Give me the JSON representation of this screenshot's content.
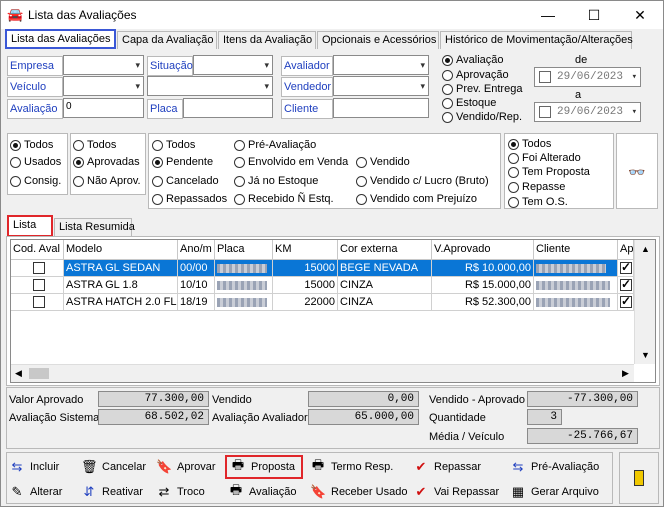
{
  "window": {
    "title": "Lista das Avaliações",
    "minimize": "—",
    "maximize": "☐",
    "close": "✕"
  },
  "tabs": [
    {
      "label": "Lista das Avaliações"
    },
    {
      "label": "Capa da Avaliação"
    },
    {
      "label": "Itens da Avaliação"
    },
    {
      "label": "Opcionais e Acessórios"
    },
    {
      "label": "Histórico de Movimentação/Alterações"
    }
  ],
  "filters": {
    "empresa_label": "Empresa",
    "veiculo_label": "Veículo",
    "avaliacao_label": "Avaliação",
    "avaliacao_value": "0",
    "situacao_label": "Situação",
    "placa_label": "Placa",
    "avaliador_label": "Avaliador",
    "vendedor_label": "Vendedor",
    "cliente_label": "Cliente"
  },
  "date_type": {
    "options": [
      "Avaliação",
      "Aprovação",
      "Prev. Entrega",
      "Estoque",
      "Vendido/Rep."
    ],
    "selected": "Avaliação",
    "from_label": "de",
    "from_value": "29/06/2023",
    "to_label": "a",
    "to_value": "29/06/2023"
  },
  "group1": {
    "options": [
      "Todos",
      "Usados",
      "Consig."
    ],
    "selected": "Todos"
  },
  "group2": {
    "options": [
      "Todos",
      "Aprovadas",
      "Não Aprov."
    ],
    "selected": "Aprovadas"
  },
  "group3": {
    "options": [
      "Todos",
      "Pré-Avaliação",
      "Pendente",
      "Envolvido em Venda",
      "Vendido",
      "Cancelado",
      "Já no Estoque",
      "Vendido c/ Lucro (Bruto)",
      "Repassados",
      "Recebido Ñ Estq.",
      "Vendido com Prejuízo"
    ],
    "selected": "Pendente"
  },
  "group4": {
    "options": [
      "Todos",
      "Foi Alterado",
      "Tem Proposta",
      "Repasse",
      "Tem O.S."
    ],
    "selected": "Todos"
  },
  "view_tabs": [
    {
      "label": "Lista"
    },
    {
      "label": "Lista Resumida"
    }
  ],
  "table": {
    "columns": [
      "Cod. Aval",
      "Modelo",
      "Ano/m",
      "Placa",
      "KM",
      "Cor externa",
      "V.Aprovado",
      "Cliente",
      "Apr"
    ],
    "rows": [
      {
        "modelo": "ASTRA GL SEDAN",
        "ano": "00/00",
        "km": "15000",
        "cor": "BEGE NEVADA",
        "valor": "R$ 10.000,00",
        "apr": true
      },
      {
        "modelo": "ASTRA GL 1.8",
        "ano": "10/10",
        "km": "15000",
        "cor": "CINZA",
        "valor": "R$ 15.000,00",
        "apr": true
      },
      {
        "modelo": "ASTRA HATCH  2.0 FL",
        "ano": "18/19",
        "km": "22000",
        "cor": "CINZA",
        "valor": "R$ 52.300,00",
        "apr": true
      }
    ]
  },
  "summary": {
    "valor_aprovado_label": "Valor Aprovado",
    "valor_aprovado": "77.300,00",
    "avaliacao_sistema_label": "Avaliação Sistema",
    "avaliacao_sistema": "68.502,02",
    "vendido_label": "Vendido",
    "vendido": "0,00",
    "avaliacao_avaliador_label": "Avaliação Avaliador",
    "avaliacao_avaliador": "65.000,00",
    "vendido_aprovado_label": "Vendido - Aprovado",
    "vendido_aprovado": "-77.300,00",
    "quantidade_label": "Quantidade",
    "quantidade": "3",
    "media_label": "Média / Veículo",
    "media": "-25.766,67"
  },
  "actions": {
    "incluir": "Incluir",
    "cancelar": "Cancelar",
    "aprovar": "Aprovar",
    "proposta": "Proposta",
    "termo": "Termo Resp.",
    "repassar": "Repassar",
    "pre_avaliacao": "Pré-Avaliação",
    "alterar": "Alterar",
    "reativar": "Reativar",
    "troco": "Troco",
    "avaliacao": "Avaliação",
    "receber_usado": "Receber Usado",
    "vai_repassar": "Vai Repassar",
    "gerar_arquivo": "Gerar Arquivo"
  }
}
